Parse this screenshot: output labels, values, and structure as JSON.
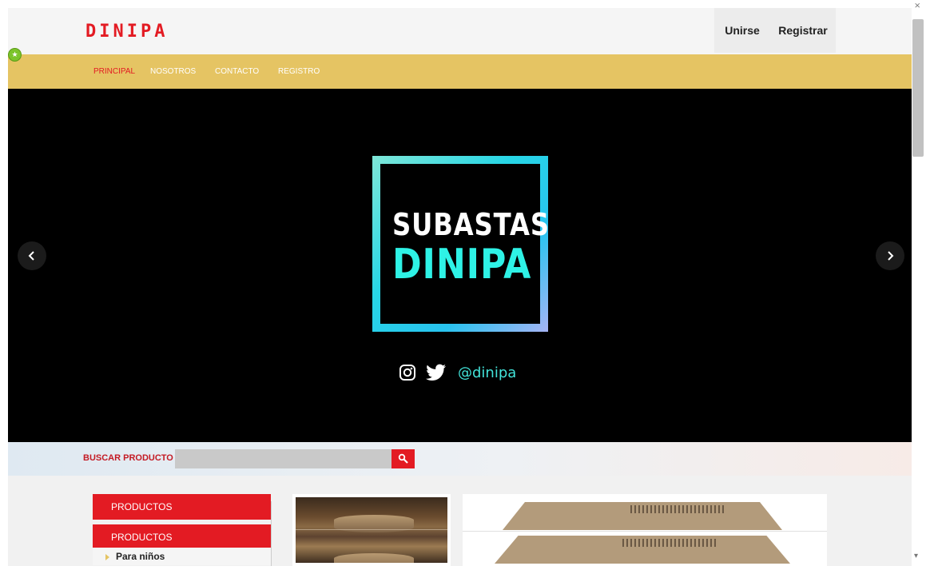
{
  "header": {
    "logo": "DINIPA",
    "join_label": "Unirse",
    "register_label": "Registrar"
  },
  "nav": {
    "items": [
      {
        "label": "PRINCIPAL",
        "active": true
      },
      {
        "label": "NOSOTROS",
        "active": false
      },
      {
        "label": "CONTACTO",
        "active": false
      },
      {
        "label": "REGISTRO",
        "active": false
      }
    ]
  },
  "hero": {
    "logo_line1": "SUBASTAS",
    "logo_line2": "DINIPA",
    "social_handle": "@dinipa",
    "social_icons": [
      "instagram-icon",
      "twitter-icon"
    ],
    "prev_icon": "chevron-left-icon",
    "next_icon": "chevron-right-icon"
  },
  "search": {
    "label": "BUSCAR PRODUCTO",
    "value": "",
    "button_icon": "search-icon"
  },
  "sidebar": {
    "header1": "PRODUCTOS",
    "header2": "PRODUCTOS",
    "items": [
      {
        "label": "Para niños"
      }
    ]
  },
  "colors": {
    "brand_red": "#e31b23",
    "nav_gold": "#e5c463",
    "hero_bg": "#000000",
    "hero_cyan": "#2ef2e6"
  }
}
